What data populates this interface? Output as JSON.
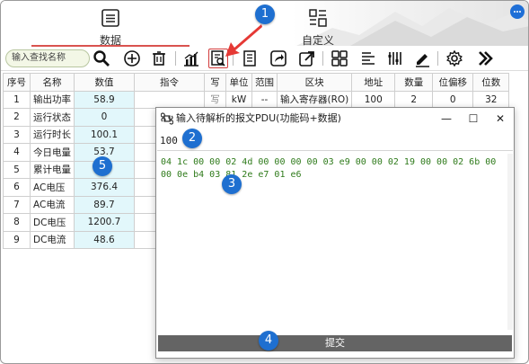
{
  "header": {
    "tabs": [
      {
        "label": "数据",
        "icon": "list-box-icon",
        "active": true
      },
      {
        "label": "自定义",
        "icon": "grid-dashboard-icon",
        "active": false
      }
    ]
  },
  "toolbar": {
    "search_placeholder": "输入查找名称",
    "buttons": [
      "search-icon",
      "add-icon",
      "delete-icon",
      "chart-icon",
      "parse-message-icon",
      "document-icon",
      "export-icon",
      "share-icon",
      "grid-view-icon",
      "align-left-icon",
      "columns-icon",
      "edit-icon",
      "settings-icon",
      "more-right-icon"
    ]
  },
  "table": {
    "headers": [
      "序号",
      "名称",
      "数值",
      "指令",
      "写",
      "单位",
      "范围",
      "区块",
      "地址",
      "数量",
      "位偏移",
      "位数"
    ],
    "rows": [
      {
        "no": "1",
        "name": "输出功率",
        "value": "58.9",
        "cmd": "",
        "write": "写",
        "unit": "kW",
        "range": "--",
        "block": "输入寄存器(RO)",
        "addr": "100",
        "count": "2",
        "offset": "0",
        "bits": "32"
      },
      {
        "no": "2",
        "name": "运行状态",
        "value": "0"
      },
      {
        "no": "3",
        "name": "运行时长",
        "value": "100.1"
      },
      {
        "no": "4",
        "name": "今日电量",
        "value": "53.7"
      },
      {
        "no": "5",
        "name": "累计电量",
        "value": ""
      },
      {
        "no": "6",
        "name": "AC电压",
        "value": "376.4"
      },
      {
        "no": "7",
        "name": "AC电流",
        "value": "89.7"
      },
      {
        "no": "8",
        "name": "DC电压",
        "value": "1200.7"
      },
      {
        "no": "9",
        "name": "DC电流",
        "value": "48.6"
      }
    ]
  },
  "dialog": {
    "title": "输入待解析的报文PDU(功能码+数据)",
    "input_value": "100",
    "hex_text": "04 1c 00 00 02 4d 00 00 00 00 03 e9 00 00 02 19 00 00 02 6b 00 00 0e b4 03 81 2e e7 01 e6",
    "submit_label": "提交",
    "controls": {
      "minimize": "—",
      "maximize": "☐",
      "close": "✕"
    }
  },
  "callouts": [
    "1",
    "2",
    "3",
    "4",
    "5"
  ],
  "colors": {
    "accent": "#1e6fd0",
    "value_bg": "#e2f7fb",
    "hex_text": "#2e7a1a",
    "highlight": "#d23b3b"
  }
}
